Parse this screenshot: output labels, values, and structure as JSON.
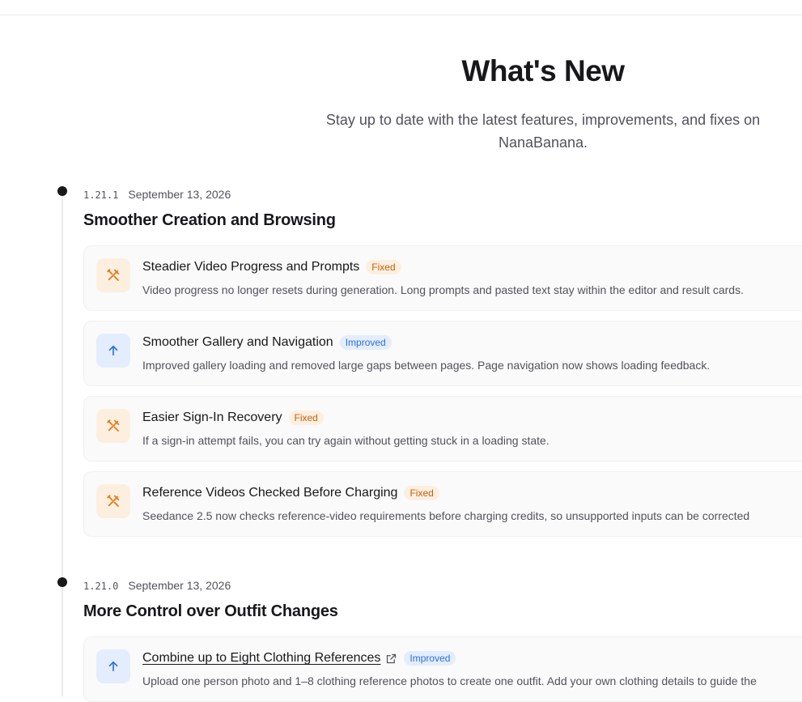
{
  "header": {
    "title": "What's New",
    "subtitle": "Stay up to date with the latest features, improvements, and fixes on NanaBanana."
  },
  "colors": {
    "fixed_accent": "#e37a12",
    "improved_accent": "#2f6fd8",
    "timeline_dot": "#18181b"
  },
  "releases": [
    {
      "version": "1.21.1",
      "date": "September 13, 2026",
      "title": "Smoother Creation and Browsing",
      "items": [
        {
          "icon": "wrench-screwdriver-icon",
          "title": "Steadier Video Progress and Prompts",
          "badge": "Fixed",
          "description": "Video progress no longer resets during generation. Long prompts and pasted text stay within the editor and result cards."
        },
        {
          "icon": "arrow-up-icon",
          "title": "Smoother Gallery and Navigation",
          "badge": "Improved",
          "description": "Improved gallery loading and removed large gaps between pages. Page navigation now shows loading feedback."
        },
        {
          "icon": "wrench-screwdriver-icon",
          "title": "Easier Sign-In Recovery",
          "badge": "Fixed",
          "description": "If a sign-in attempt fails, you can try again without getting stuck in a loading state."
        },
        {
          "icon": "wrench-screwdriver-icon",
          "title": "Reference Videos Checked Before Charging",
          "badge": "Fixed",
          "description": "Seedance 2.5 now checks reference-video requirements before charging credits, so unsupported inputs can be corrected"
        }
      ]
    },
    {
      "version": "1.21.0",
      "date": "September 13, 2026",
      "title": "More Control over Outfit Changes",
      "items": [
        {
          "icon": "arrow-up-icon",
          "title": "Combine up to Eight Clothing References",
          "badge": "Improved",
          "description": "Upload one person photo and 1–8 clothing reference photos to create one outfit. Add your own clothing details to guide the"
        }
      ]
    }
  ]
}
